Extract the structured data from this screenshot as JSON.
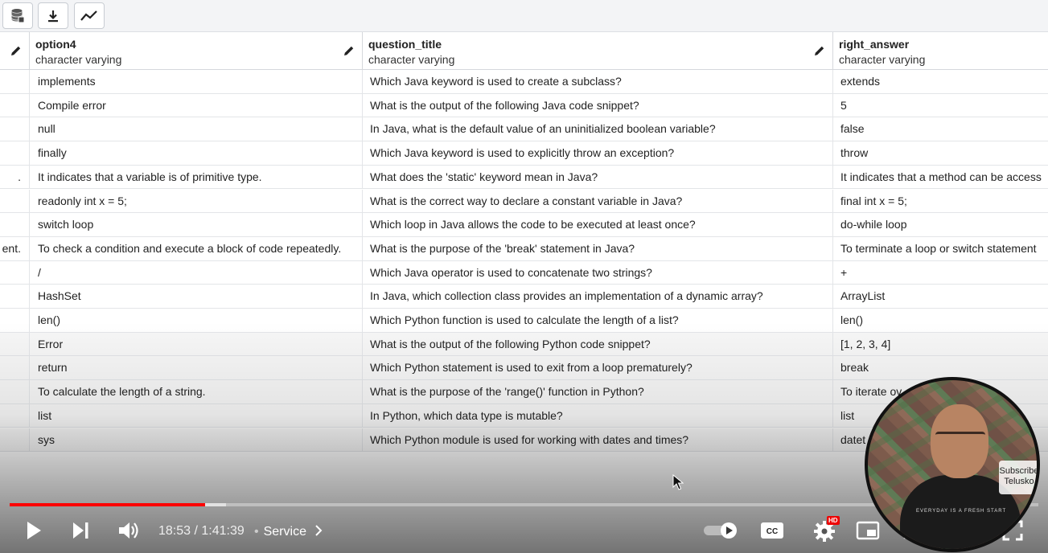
{
  "columns": [
    {
      "name": "option4",
      "type": "character varying"
    },
    {
      "name": "question_title",
      "type": "character varying"
    },
    {
      "name": "right_answer",
      "type": "character varying"
    }
  ],
  "rows": [
    {
      "prev": "",
      "option4": "implements",
      "question_title": "Which Java keyword is used to create a subclass?",
      "right_answer": "extends"
    },
    {
      "prev": "",
      "option4": "Compile error",
      "question_title": "What is the output of the following Java code snippet?",
      "right_answer": "5"
    },
    {
      "prev": "",
      "option4": "null",
      "question_title": "In Java, what is the default value of an uninitialized boolean variable?",
      "right_answer": "false"
    },
    {
      "prev": "",
      "option4": "finally",
      "question_title": "Which Java keyword is used to explicitly throw an exception?",
      "right_answer": "throw"
    },
    {
      "prev": ".",
      "option4": "It indicates that a variable is of primitive type.",
      "question_title": "What does the 'static' keyword mean in Java?",
      "right_answer": "It indicates that a method can be access"
    },
    {
      "prev": "",
      "option4": "readonly int x = 5;",
      "question_title": "What is the correct way to declare a constant variable in Java?",
      "right_answer": "final int x = 5;"
    },
    {
      "prev": "",
      "option4": "switch loop",
      "question_title": "Which loop in Java allows the code to be executed at least once?",
      "right_answer": "do-while loop"
    },
    {
      "prev": "ent.",
      "option4": "To check a condition and execute a block of code repeatedly.",
      "question_title": "What is the purpose of the 'break' statement in Java?",
      "right_answer": "To terminate a loop or switch statement"
    },
    {
      "prev": "",
      "option4": "/",
      "question_title": "Which Java operator is used to concatenate two strings?",
      "right_answer": "+"
    },
    {
      "prev": "",
      "option4": "HashSet",
      "question_title": "In Java, which collection class provides an implementation of a dynamic array?",
      "right_answer": "ArrayList"
    },
    {
      "prev": "",
      "option4": "len()",
      "question_title": "Which Python function is used to calculate the length of a list?",
      "right_answer": "len()"
    },
    {
      "prev": "",
      "option4": "Error",
      "question_title": "What is the output of the following Python code snippet?",
      "right_answer": "[1, 2, 3, 4]"
    },
    {
      "prev": "",
      "option4": "return",
      "question_title": "Which Python statement is used to exit from a loop prematurely?",
      "right_answer": "break"
    },
    {
      "prev": "",
      "option4": "To calculate the length of a string.",
      "question_title": "What is the purpose of the 'range()' function in Python?",
      "right_answer": "To iterate ov"
    },
    {
      "prev": "",
      "option4": "list",
      "question_title": "In Python, which data type is mutable?",
      "right_answer": "list"
    },
    {
      "prev": "",
      "option4": "sys",
      "question_title": "Which Python module is used for working with dates and times?",
      "right_answer": "datet"
    }
  ],
  "player": {
    "time_current": "18:53",
    "time_separator": " / ",
    "time_total": "1:41:39",
    "chapter": "Service",
    "progress_played_pct": 19,
    "progress_buffered_pct": 21,
    "quality_badge": "HD",
    "accent": "#ff0000"
  },
  "webcam": {
    "subscribe_label": "Subscribe",
    "channel_label": "Telusko",
    "shirt_text": "EVERYDAY IS A FRESH START"
  },
  "toolbar": {
    "icons": [
      "database-icon",
      "download-icon",
      "chart-line-icon"
    ]
  }
}
